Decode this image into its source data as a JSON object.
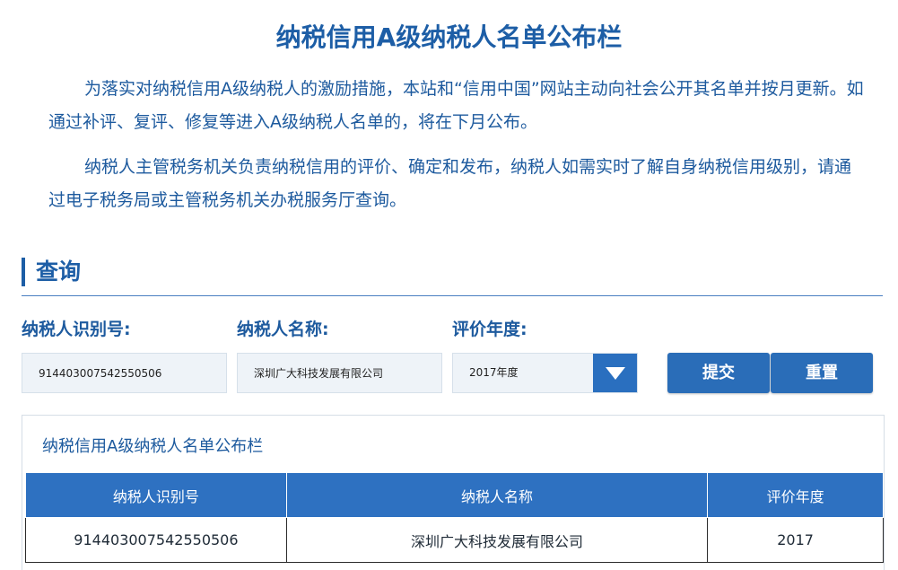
{
  "page": {
    "title": "纳税信用A级纳税人名单公布栏",
    "intro_paragraph_1": "为落实对纳税信用A级纳税人的激励措施，本站和“信用中国”网站主动向社会公开其名单并按月更新。如通过补评、复评、修复等进入A级纳税人名单的，将在下月公布。",
    "intro_paragraph_2": "纳税人主管税务机关负责纳税信用的评价、确定和发布，纳税人如需实时了解自身纳税信用级别，请通过电子税务局或主管税务机关办税服务厅查询。"
  },
  "query": {
    "heading": "查询",
    "taxpayer_id_label": "纳税人识别号:",
    "taxpayer_id_value": "914403007542550506",
    "taxpayer_name_label": "纳税人名称:",
    "taxpayer_name_value": "深圳广大科技发展有限公司",
    "year_label": "评价年度:",
    "year_selected": "2017年度",
    "submit_label": "提交",
    "reset_label": "重置"
  },
  "results": {
    "title": "纳税信用A级纳税人名单公布栏",
    "columns": [
      "纳税人识别号",
      "纳税人名称",
      "评价年度"
    ],
    "rows": [
      [
        "914403007542550506",
        "深圳广大科技发展有限公司",
        "2017"
      ]
    ]
  },
  "colors": {
    "primary": "#2e71c1",
    "text_blue": "#1d5a9e",
    "input_bg": "#eef3f8"
  },
  "icons": {
    "select_arrow": "triangle-down-icon"
  }
}
